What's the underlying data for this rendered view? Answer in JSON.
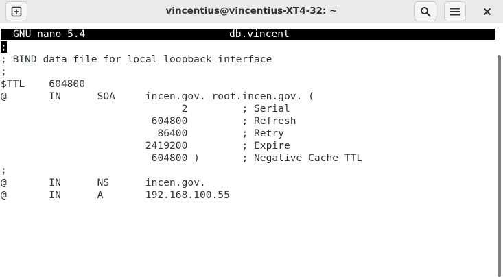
{
  "window": {
    "title": "vincentius@vincentius-XT4-32: ~"
  },
  "toolbar": {
    "new_tab_icon": "new-tab-icon",
    "search_icon": "search-icon",
    "menu_icon": "hamburger-menu-icon",
    "close_icon": "close-icon"
  },
  "nano": {
    "app_label": "GNU nano 5.4",
    "file_name": "db.vincent",
    "cursor_char": ";"
  },
  "file_lines": [
    "",
    "; BIND data file for local loopback interface",
    ";",
    "$TTL    604800",
    "@       IN      SOA     incen.gov. root.incen.gov. (",
    "                              2         ; Serial",
    "                         604800         ; Refresh",
    "                          86400         ; Retry",
    "                        2419200         ; Expire",
    "                         604800 )       ; Negative Cache TTL",
    ";",
    "@       IN      NS      incen.gov.",
    "@       IN      A       192.168.100.55"
  ],
  "colors": {
    "titlebar": "#ebebeb",
    "header_bg": "#000000",
    "text": "#2e3436"
  }
}
